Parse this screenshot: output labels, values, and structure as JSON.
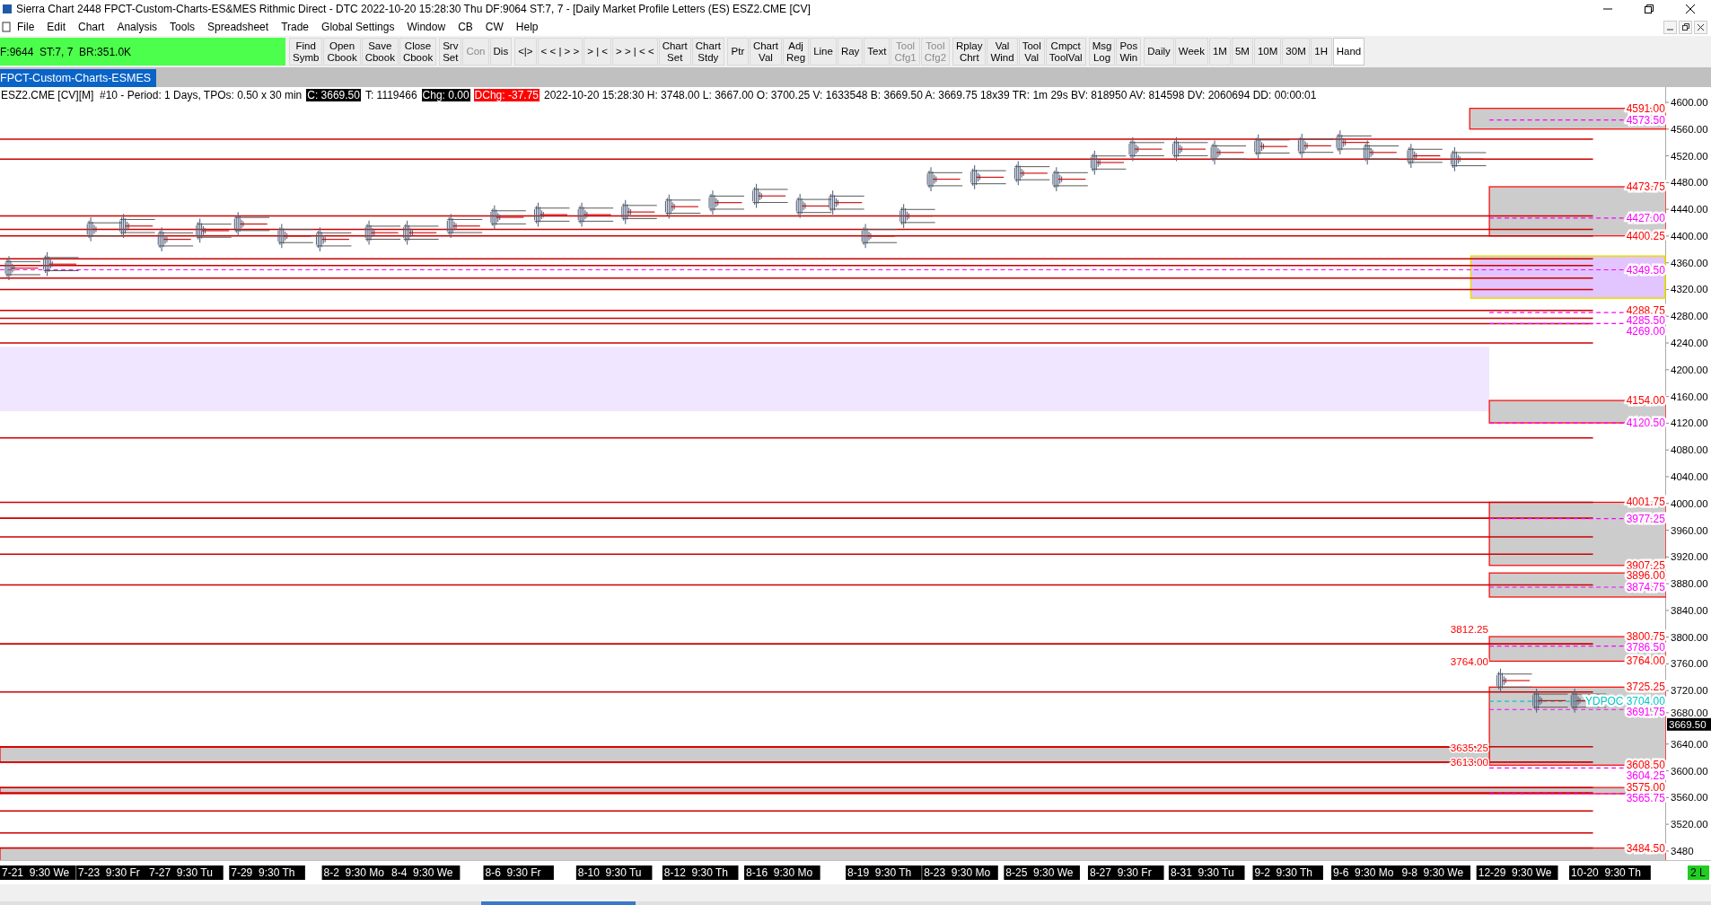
{
  "window": {
    "title": "Sierra Chart 2448 FPCT-Custom-Charts-ES&MES  Rithmic Direct - DTC 2022-10-20  15:28:30 Thu  DF:9064  ST:7, 7 - [Daily Market Profile Letters (ES) ESZ2.CME [CV]"
  },
  "menu": [
    "File",
    "Edit",
    "Chart",
    "Analysis",
    "Tools",
    "Spreadsheet",
    "Trade",
    "Global Settings",
    "Window",
    "CB",
    "CW",
    "Help"
  ],
  "status_box": "F:9644  ST:7, 7  BR:351.0K",
  "toolbar": [
    {
      "buttons": [
        {
          "lines": [
            "Find",
            "Symb"
          ],
          "disabled": false,
          "selected": false
        },
        {
          "lines": [
            "Open",
            "Cbook"
          ],
          "disabled": false,
          "selected": false
        },
        {
          "lines": [
            "Save",
            "Cbook"
          ],
          "disabled": false,
          "selected": false
        },
        {
          "lines": [
            "Close",
            "Cbook"
          ],
          "disabled": false,
          "selected": false
        }
      ]
    },
    {
      "buttons": [
        {
          "lines": [
            "Srv",
            "Set"
          ],
          "disabled": false,
          "selected": false
        },
        {
          "lines": [
            "Con"
          ],
          "disabled": true,
          "selected": false
        },
        {
          "lines": [
            "Dis"
          ],
          "disabled": false,
          "selected": false
        }
      ]
    },
    {
      "buttons": [
        {
          "lines": [
            "<|>"
          ],
          "disabled": false,
          "selected": false
        },
        {
          "lines": [
            "< < | > >"
          ],
          "disabled": false,
          "selected": false
        },
        {
          "lines": [
            "> | <"
          ],
          "disabled": false,
          "selected": false
        },
        {
          "lines": [
            "> > | < <"
          ],
          "disabled": false,
          "selected": false
        },
        {
          "lines": [
            "Chart",
            "Set"
          ],
          "disabled": false,
          "selected": false
        },
        {
          "lines": [
            "Chart",
            "Stdy"
          ],
          "disabled": false,
          "selected": false
        }
      ]
    },
    {
      "buttons": [
        {
          "lines": [
            "Ptr"
          ],
          "disabled": false,
          "selected": false
        },
        {
          "lines": [
            "Chart",
            "Val"
          ],
          "disabled": false,
          "selected": false
        },
        {
          "lines": [
            "Adj",
            "Reg"
          ],
          "disabled": false,
          "selected": false
        },
        {
          "lines": [
            "Line"
          ],
          "disabled": false,
          "selected": false
        },
        {
          "lines": [
            "Ray"
          ],
          "disabled": false,
          "selected": false
        },
        {
          "lines": [
            "Text"
          ],
          "disabled": false,
          "selected": false
        },
        {
          "lines": [
            "Tool",
            "Cfg1"
          ],
          "disabled": true,
          "selected": false
        },
        {
          "lines": [
            "Tool",
            "Cfg2"
          ],
          "disabled": true,
          "selected": false
        }
      ]
    },
    {
      "buttons": [
        {
          "lines": [
            "Rplay",
            "Chrt"
          ],
          "disabled": false,
          "selected": false
        },
        {
          "lines": [
            "Val",
            "Wind"
          ],
          "disabled": false,
          "selected": false
        },
        {
          "lines": [
            "Tool",
            "Val"
          ],
          "disabled": false,
          "selected": false
        },
        {
          "lines": [
            "Cmpct",
            "ToolVal"
          ],
          "disabled": false,
          "selected": false
        }
      ]
    },
    {
      "buttons": [
        {
          "lines": [
            "Msg",
            "Log"
          ],
          "disabled": false,
          "selected": false
        },
        {
          "lines": [
            "Pos",
            "Win"
          ],
          "disabled": false,
          "selected": false
        }
      ]
    },
    {
      "buttons": [
        {
          "lines": [
            "Daily"
          ],
          "disabled": false,
          "selected": false
        },
        {
          "lines": [
            "Week"
          ],
          "disabled": false,
          "selected": false
        },
        {
          "lines": [
            "1M"
          ],
          "disabled": false,
          "selected": false
        },
        {
          "lines": [
            "5M"
          ],
          "disabled": false,
          "selected": false
        },
        {
          "lines": [
            "10M"
          ],
          "disabled": false,
          "selected": false
        },
        {
          "lines": [
            "30M"
          ],
          "disabled": false,
          "selected": false
        },
        {
          "lines": [
            "1H"
          ],
          "disabled": false,
          "selected": false
        },
        {
          "lines": [
            "Hand"
          ],
          "disabled": false,
          "selected": true
        }
      ]
    }
  ],
  "chart_tab": {
    "label": "FPCT-Custom-Charts-ESMES",
    "selected": true
  },
  "info_line": [
    {
      "kind": "plain",
      "text": "ESZ2.CME [CV][M]  #10 - Period: 1 Days, TPOs: 0.50 x 30 min"
    },
    {
      "kind": "dark",
      "text": "C: 3669.50"
    },
    {
      "kind": "plain",
      "text": "T: 1119466"
    },
    {
      "kind": "dark",
      "text": "Chg: 0.00"
    },
    {
      "kind": "alert",
      "text": "DChg: -37.75"
    },
    {
      "kind": "plain",
      "text": "2022-10-20 15:28:30 H: 3748.00 L: 3667.00 O: 3700.25 V: 1633548 B: 3669.50 A: 3669.75 18x39 TR: 1m 29s BV: 818950 AV: 814598 DV: 2060694 DD: 00:00:01"
    }
  ],
  "price_labels": [
    {
      "text": "4591.00",
      "color": "#ff0000"
    },
    {
      "text": "4573.50",
      "color": "#ff00ff"
    },
    {
      "text": "4473.75",
      "color": "#ff0000"
    },
    {
      "text": "4427.00",
      "color": "#ff00ff"
    },
    {
      "text": "4400.25",
      "color": "#ff0000"
    },
    {
      "text": "4349.50",
      "color": "#ff00ff"
    },
    {
      "text": "4288.75",
      "color": "#ff0000"
    },
    {
      "text": "4285.50",
      "color": "#ff00ff"
    },
    {
      "text": "4269.00",
      "color": "#ff00ff"
    },
    {
      "text": "4154.00",
      "color": "#ff0000"
    },
    {
      "text": "4120.50",
      "color": "#ff00ff"
    },
    {
      "text": "4001.75",
      "color": "#ff0000"
    },
    {
      "text": "3977.25",
      "color": "#ff00ff"
    },
    {
      "text": "3907.25",
      "color": "#ff0000"
    },
    {
      "text": "3896.00",
      "color": "#ff0000"
    },
    {
      "text": "3874.75",
      "color": "#ff00ff"
    },
    {
      "text": "3800.75",
      "color": "#ff0000"
    },
    {
      "text": "3786.50",
      "color": "#ff00ff"
    },
    {
      "text": "3764.00",
      "color": "#ff0000"
    },
    {
      "text": "3725.25",
      "color": "#ff0000"
    },
    {
      "text": "YDPOC  3704.00",
      "color": "#00c8c8"
    },
    {
      "text": "3691.75",
      "color": "#ff00ff"
    },
    {
      "text": "3608.50",
      "color": "#ff0000"
    },
    {
      "text": "3604.25",
      "color": "#ff00ff"
    },
    {
      "text": "3575.00",
      "color": "#ff0000"
    },
    {
      "text": "3565.75",
      "color": "#ff00ff"
    },
    {
      "text": "3484.50",
      "color": "#ff0000"
    }
  ],
  "left_labels": [
    "3812.25",
    "3764.00",
    "3635.25",
    "3613.00"
  ],
  "price_axis": {
    "ticks": [
      "4600.00",
      "4560.00",
      "4520.00",
      "4480.00",
      "4440.00",
      "4400.00",
      "4360.00",
      "4320.00",
      "4280.00",
      "4240.00",
      "4200.00",
      "4160.00",
      "4120.00",
      "4080.00",
      "4040.00",
      "4000.00",
      "3960.00",
      "3920.00",
      "3880.00",
      "3840.00",
      "3800.00",
      "3760.00",
      "3720.00",
      "3680.00",
      "3640.00",
      "3600.00",
      "3560.00",
      "3520.00",
      "3480"
    ],
    "current_price": "3669.50"
  },
  "date_axis": [
    "7-21  9:30 We",
    "7-23  9:30 Fr",
    "7-27  9:30 Tu",
    "7-29  9:30 Th",
    "8-2  9:30 Mo",
    "8-4  9:30 We",
    "8-6  9:30 Fr",
    "8-10  9:30 Tu",
    "8-12  9:30 Th",
    "8-16  9:30 Mo",
    "8-19  9:30 Th",
    "8-23  9:30 Mo",
    "8-25  9:30 We",
    "8-27  9:30 Fr",
    "8-31  9:30 Tu",
    "9-2  9:30 Th",
    "9-6  9:30 Mo",
    "9-8  9:30 We",
    "12-29  9:30 We",
    "10-20  9:30 Th"
  ],
  "status_badge": "2 L"
}
